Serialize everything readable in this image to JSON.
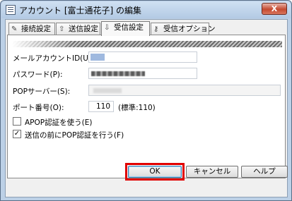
{
  "window": {
    "title": "アカウント [富士通花子] の編集",
    "close_label": "X"
  },
  "tabs": [
    {
      "label": "接続設定",
      "icon": "wrench-icon",
      "active": false
    },
    {
      "label": "送信設定",
      "icon": "send-icon",
      "active": false
    },
    {
      "label": "受信設定",
      "icon": "receive-icon",
      "active": true
    },
    {
      "label": "受信オプション",
      "icon": "key-icon",
      "active": false
    }
  ],
  "form": {
    "account_id_label": "メールアカウントID(U):",
    "password_label": "パスワード(P):",
    "pop_server_label": "POPサーバー(S):",
    "port_label": "ポート番号(O):",
    "port_value": "110",
    "port_default": "(標準:110)",
    "apop_label": "APOP認証を使う(E)",
    "apop_checked": false,
    "pop_before_send_label": "送信の前にPOP認証を行う(F)",
    "pop_before_send_checked": true
  },
  "buttons": {
    "ok": "OK",
    "cancel": "キャンセル",
    "help": "ヘルプ"
  },
  "colors": {
    "highlight": "#e00000"
  }
}
